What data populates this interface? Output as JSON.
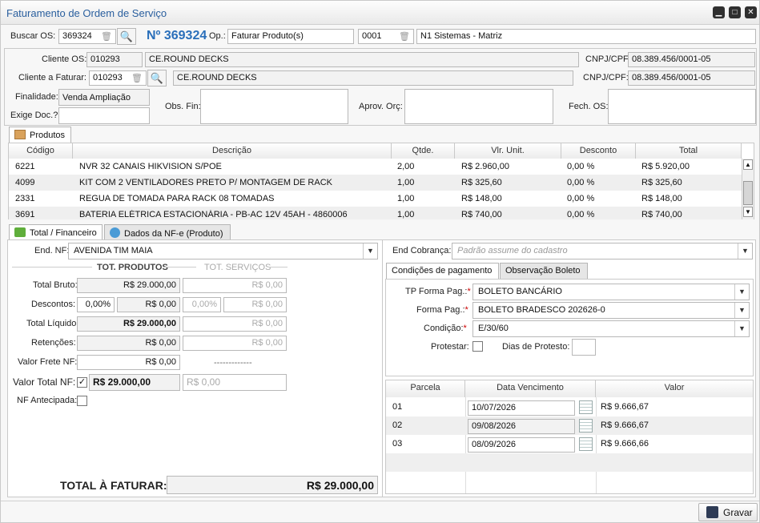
{
  "window": {
    "title": "Faturamento de Ordem de Serviço",
    "min_icon": "minimize-icon",
    "max_icon": "maximize-icon",
    "close_icon": "close-icon"
  },
  "top": {
    "buscar_label": "Buscar OS:",
    "buscar_value": "369324",
    "os_number": "Nº 369324",
    "op_label": "Op.:",
    "op_value": "Faturar Produto(s)",
    "empresa_code": "0001",
    "empresa_name": "N1 Sistemas - Matriz"
  },
  "header": {
    "cliente_os_label": "Cliente OS:",
    "cliente_os_code": "010293",
    "cliente_os_name": "CE.ROUND DECKS",
    "cnpj1_label": "CNPJ/CPF:",
    "cnpj1_value": "08.389.456/0001-05",
    "cliente_fat_label": "Cliente a Faturar:",
    "cliente_fat_code": "010293",
    "cliente_fat_name": "CE.ROUND DECKS",
    "cnpj2_label": "CNPJ/CPF:",
    "cnpj2_value": "08.389.456/0001-05",
    "finalidade_label": "Finalidade:",
    "finalidade_value": "Venda Ampliação",
    "exige_doc_label": "Exige Doc.?",
    "obs_fin_label": "Obs. Fin:",
    "aprov_orc_label": "Aprov. Orç:",
    "fech_os_label": "Fech. OS:"
  },
  "products": {
    "tab": "Produtos",
    "columns": [
      "Código",
      "Descrição",
      "Qtde.",
      "Vlr. Unit.",
      "Desconto",
      "Total"
    ],
    "rows": [
      {
        "codigo": "6221",
        "descricao": "NVR 32 CANAIS HIKVISION S/POE",
        "qtde": "2,00",
        "unit": "R$ 2.960,00",
        "desconto": "0,00 %",
        "total": "R$ 5.920,00"
      },
      {
        "codigo": "4099",
        "descricao": "KIT COM 2 VENTILADORES PRETO P/ MONTAGEM DE RACK",
        "qtde": "1,00",
        "unit": "R$ 325,60",
        "desconto": "0,00 %",
        "total": "R$ 325,60"
      },
      {
        "codigo": "2331",
        "descricao": "REGUA DE TOMADA PARA RACK 08 TOMADAS",
        "qtde": "1,00",
        "unit": "R$ 148,00",
        "desconto": "0,00 %",
        "total": "R$ 148,00"
      },
      {
        "codigo": "3691",
        "descricao": "BATERIA ELÉTRICA ESTACIONÁRIA - PB-AC 12V 45AH - 4860006",
        "qtde": "1,00",
        "unit": "R$ 740,00",
        "desconto": "0,00 %",
        "total": "R$ 740,00"
      }
    ]
  },
  "tabs": {
    "total_fin": "Total / Financeiro",
    "dados_nfe": "Dados da NF-e (Produto)"
  },
  "left": {
    "end_nf_label": "End. NF:",
    "end_nf_value": "AVENIDA TIM MAIA",
    "tot_produtos": "TOT. PRODUTOS",
    "tot_servicos": "TOT. SERVIÇOS",
    "total_bruto_label": "Total Bruto:",
    "total_bruto_prod": "R$ 29.000,00",
    "total_bruto_serv": "R$ 0,00",
    "descontos_label": "Descontos:",
    "desc_pct_prod": "0,00%",
    "desc_val_prod": "R$ 0,00",
    "desc_pct_serv": "0,00%",
    "desc_val_serv": "R$ 0,00",
    "total_liq_label": "Total Líquido:",
    "total_liq_prod": "R$ 29.000,00",
    "total_liq_serv": "R$ 0,00",
    "retencoes_label": "Retenções:",
    "ret_prod": "R$ 0,00",
    "ret_serv": "R$ 0,00",
    "frete_label": "Valor Frete NF:",
    "frete_value": "R$ 0,00",
    "frete_dash": "-------------",
    "valor_total_label": "Valor Total NF:",
    "valor_total_prod": "R$ 29.000,00",
    "valor_total_serv": "R$ 0,00",
    "nf_antecipada_label": "NF Antecipada:",
    "total_faturar_label": "TOTAL À FATURAR:",
    "total_faturar_value": "R$ 29.000,00"
  },
  "right": {
    "end_cobranca_label": "End Cobrança:",
    "end_cobranca_placeholder": "Padrão assume do cadastro",
    "tab_condicoes": "Condições de pagamento",
    "tab_obs_boleto": "Observação Boleto",
    "tp_forma_label": "TP Forma Pag.:",
    "tp_forma_value": "BOLETO BANCÁRIO",
    "forma_label": "Forma Pag.:",
    "forma_value": "BOLETO BRADESCO 202626-0",
    "condicao_label": "Condição:",
    "condicao_value": "E/30/60",
    "protestar_label": "Protestar:",
    "dias_protesto_label": "Dias de Protesto:",
    "req_mark": "*"
  },
  "parcelas": {
    "columns": [
      "Parcela",
      "Data Vencimento",
      "Valor"
    ],
    "rows": [
      {
        "parcela": "01",
        "data": "10/07/2026",
        "valor": "R$ 9.666,67"
      },
      {
        "parcela": "02",
        "data": "09/08/2026",
        "valor": "R$ 9.666,67"
      },
      {
        "parcela": "03",
        "data": "08/09/2026",
        "valor": "R$ 9.666,66"
      }
    ]
  },
  "footer": {
    "gravar": "Gravar"
  }
}
